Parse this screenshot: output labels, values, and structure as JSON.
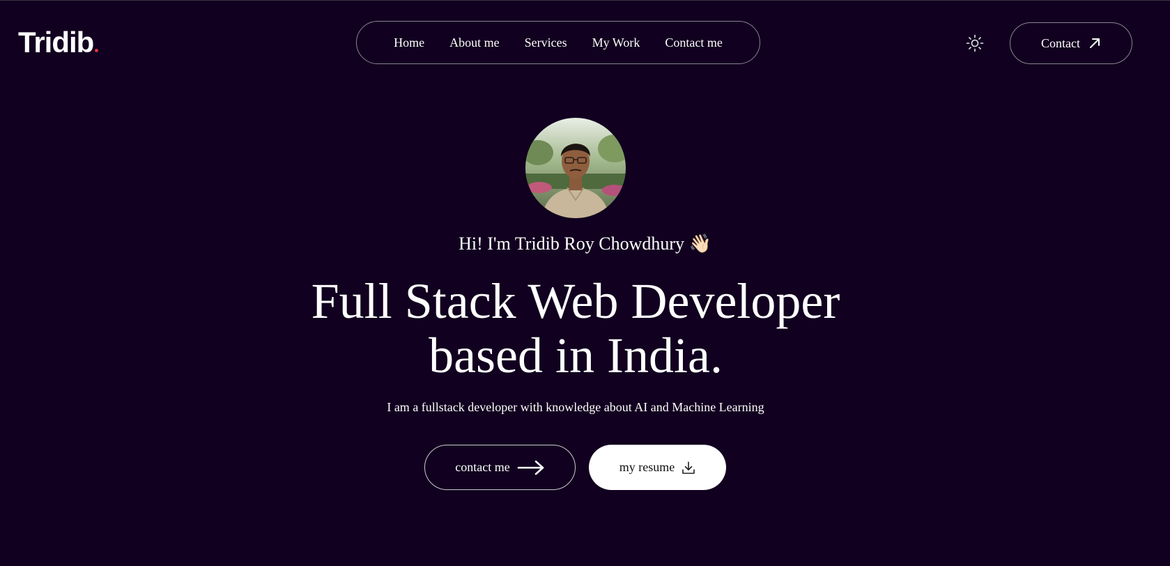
{
  "header": {
    "logo_text": "Tridib",
    "nav": [
      {
        "label": "Home"
      },
      {
        "label": "About me"
      },
      {
        "label": "Services"
      },
      {
        "label": "My Work"
      },
      {
        "label": "Contact me"
      }
    ],
    "theme_icon": "sun-icon",
    "contact_label": "Contact",
    "contact_icon": "arrow-up-right-icon"
  },
  "hero": {
    "avatar_icon": "profile-photo",
    "greeting": "Hi! I'm Tridib Roy Chowdhury",
    "greeting_emoji": "👋🏻",
    "headline_line1": "Full Stack Web Developer",
    "headline_line2": "based in India.",
    "subtext": "I am a fullstack developer with knowledge about AI and Machine Learning",
    "cta_primary_label": "contact me",
    "cta_primary_icon": "arrow-right-icon",
    "cta_secondary_label": "my resume",
    "cta_secondary_icon": "download-icon"
  },
  "colors": {
    "background": "#11001f",
    "text": "#ffffff",
    "border": "#8b8394",
    "logo_dot": "#e0303c"
  }
}
